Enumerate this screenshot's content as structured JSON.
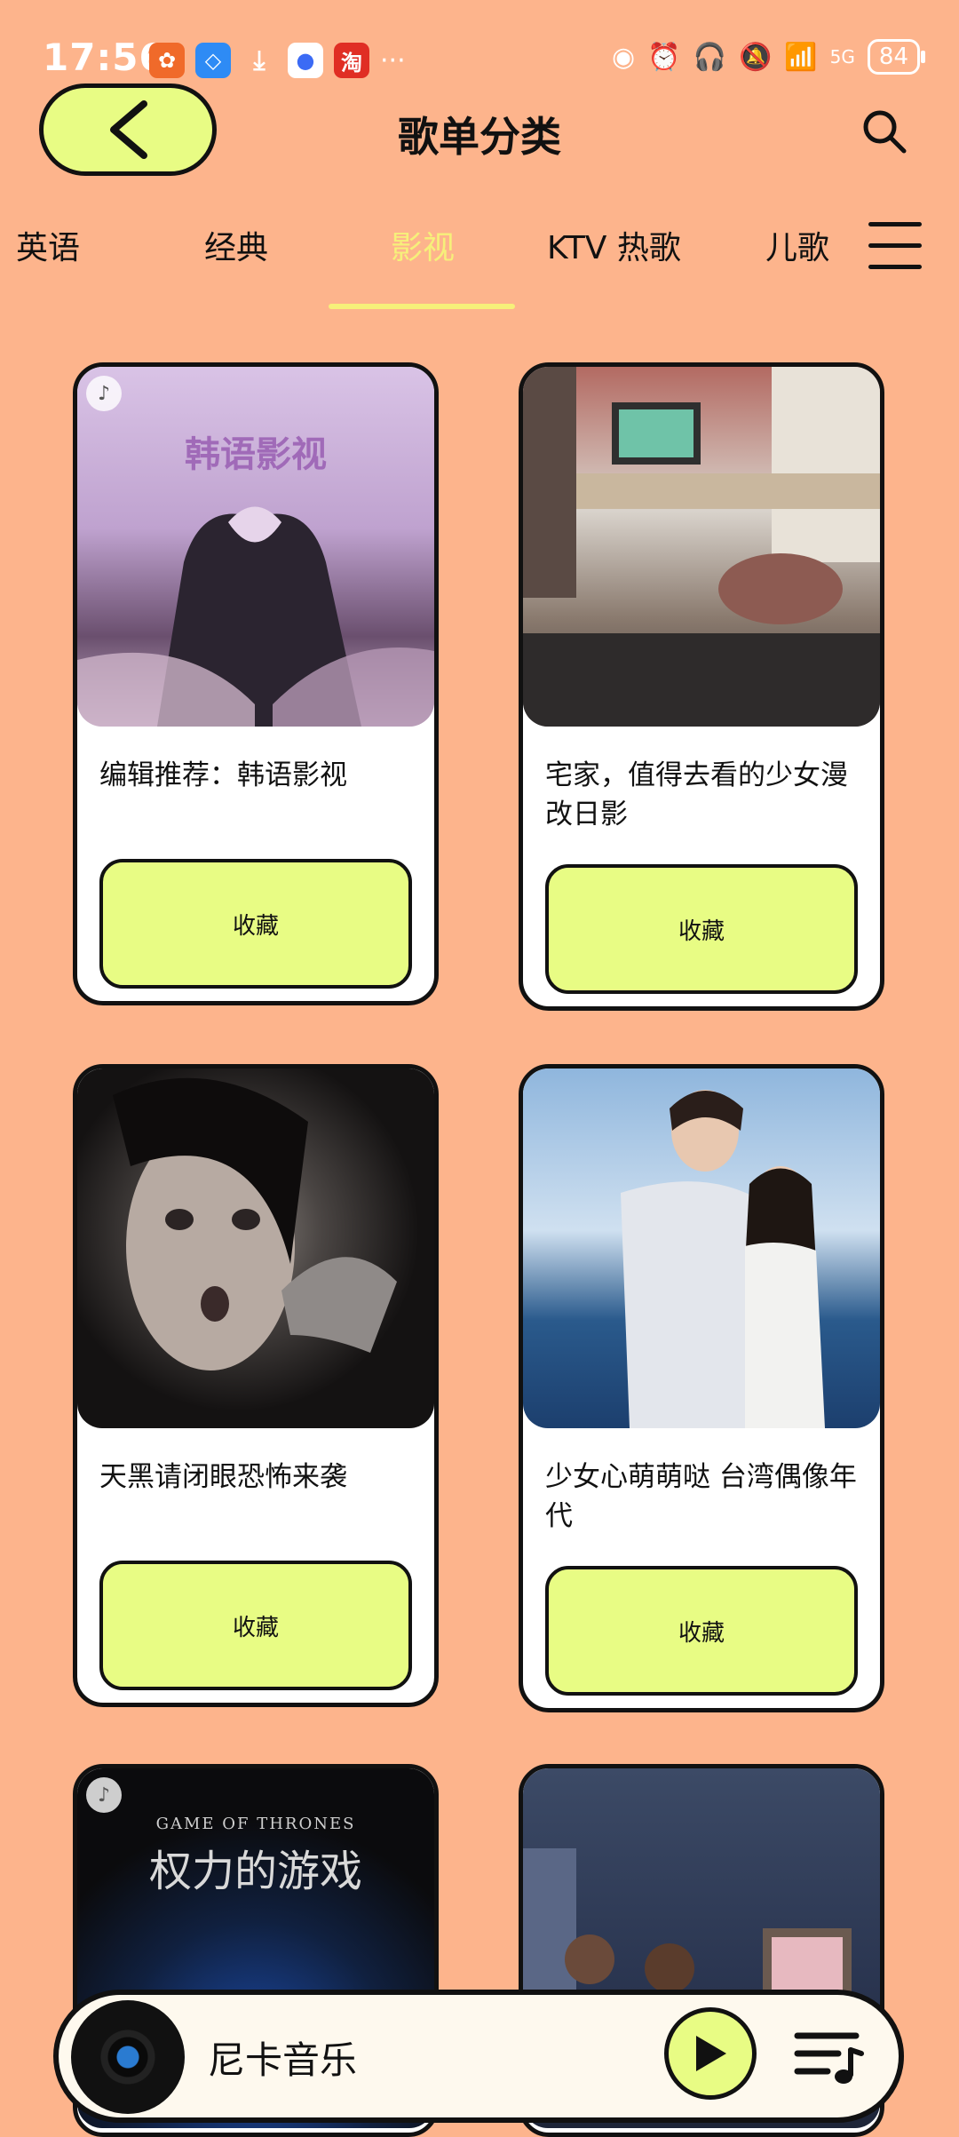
{
  "status_bar": {
    "time": "17:56",
    "network": "5G",
    "battery": "84"
  },
  "header": {
    "title": "歌单分类"
  },
  "tabs": [
    {
      "label": "英语"
    },
    {
      "label": "经典"
    },
    {
      "label": "影视"
    },
    {
      "label": "KTV 热歌"
    },
    {
      "label": "儿歌"
    }
  ],
  "active_tab": "影视",
  "cards": [
    {
      "title": "编辑推荐：韩语影视",
      "button": "收藏",
      "cover_text": "韩语影视"
    },
    {
      "title": "宅家，值得去看的少女漫改日影",
      "button": "收藏"
    },
    {
      "title": "天黑请闭眼恐怖来袭",
      "button": "收藏"
    },
    {
      "title": "少女心萌萌哒 台湾偶像年代",
      "button": "收藏"
    },
    {
      "cover_text_en": "GAME OF THRONES",
      "cover_text": "权力的游戏"
    },
    {}
  ],
  "player": {
    "title": "尼卡音乐"
  },
  "colors": {
    "background": "#FDB48C",
    "accent": "#E8FC84",
    "active_tab": "#F6F07A"
  }
}
